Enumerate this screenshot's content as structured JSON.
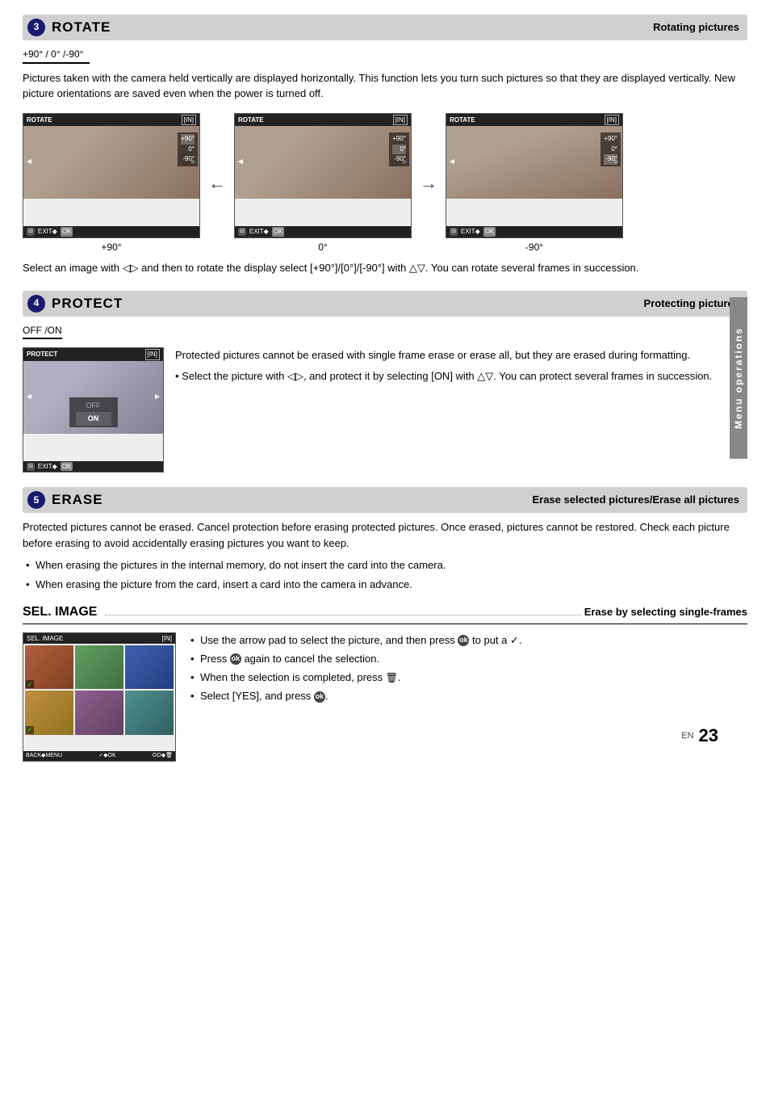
{
  "rotate": {
    "section_number": "3",
    "title": "ROTATE",
    "subtitle": "Rotating pictures",
    "selector": "+90° /   0°   /-90°",
    "description": "Pictures taken with the camera held vertically are displayed horizontally. This function lets you turn such pictures so that they are displayed vertically. New picture orientations are saved even when the power is turned off.",
    "screens": [
      {
        "label": "+90°",
        "header_title": "ROTATE",
        "header_mode": "[IN]",
        "menu_items": [
          "+90°",
          "0°",
          "-90°"
        ],
        "selected": "+90°"
      },
      {
        "label": "0°",
        "header_title": "ROTATE",
        "header_mode": "[IN]",
        "menu_items": [
          "+90°",
          "0°",
          "-90°"
        ],
        "selected": "0°"
      },
      {
        "label": "-90°",
        "header_title": "ROTATE",
        "header_mode": "[IN]",
        "menu_items": [
          "+90°",
          "0°",
          "-90°"
        ],
        "selected": "-90°"
      }
    ],
    "instruction": "Select an image with ◁▷ and then to rotate the display select [+90°]/[0°]/[-90°] with △▽. You can rotate several frames in succession."
  },
  "protect": {
    "section_number": "4",
    "title": "PROTECT",
    "subtitle": "Protecting pictures",
    "selector": "OFF  /ON",
    "header_title": "PROTECT",
    "header_mode": "[IN]",
    "description": "Protected pictures cannot be erased with single frame erase or erase all, but they are erased during formatting.",
    "bullet": "Select the picture with ◁▷, and protect it by selecting [ON] with △▽. You can protect several frames in succession."
  },
  "erase": {
    "section_number": "5",
    "title": "ERASE",
    "subtitle": "Erase selected pictures/Erase all pictures",
    "description": "Protected pictures cannot be erased. Cancel protection before erasing protected pictures. Once erased, pictures cannot be restored. Check each picture before erasing to avoid accidentally erasing pictures you want to keep.",
    "bullets": [
      "When erasing the pictures in the internal memory, do not insert the card into the camera.",
      "When erasing the picture from the card, insert a card into the camera in advance."
    ]
  },
  "sel_image": {
    "title": "SEL. IMAGE",
    "subtitle": "Erase by selecting single-frames",
    "header_title": "SEL. IMAGE",
    "header_mode": "[IN]",
    "bullets": [
      "Use the arrow pad to select the picture, and then press (ok) to put a ✓.",
      "Press (ok) again to cancel the selection.",
      "When the selection is completed, press 🗑.",
      "Select [YES], and press (ok)."
    ],
    "footer_items": [
      "BACK◆MENU",
      "✓◆OK",
      "GO◆🗑"
    ]
  },
  "sidebar": {
    "label": "Menu operations"
  },
  "page": {
    "en_label": "EN",
    "number": "23"
  }
}
